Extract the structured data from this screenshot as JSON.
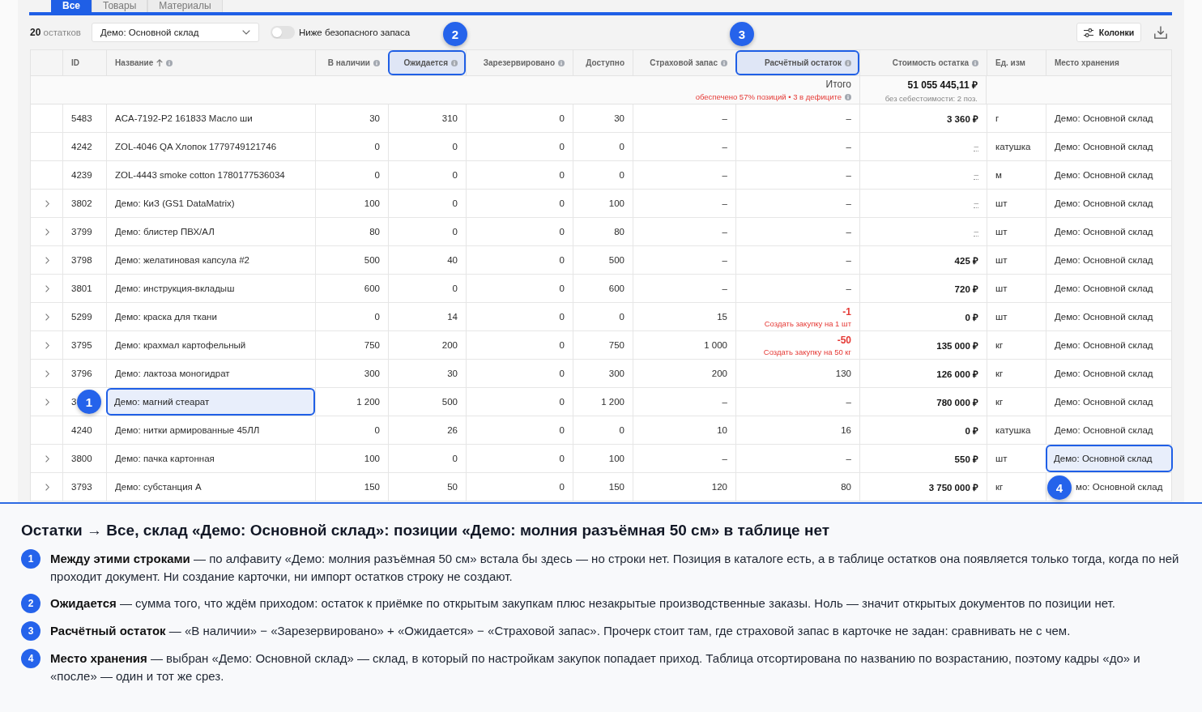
{
  "tabs": [
    {
      "label": "Все",
      "selected": true
    },
    {
      "label": "Товары",
      "selected": false
    },
    {
      "label": "Материалы",
      "selected": false
    }
  ],
  "toolbar": {
    "count_text": "**20** остатков",
    "warehouse_select": "Демо: Основной склад",
    "safety_filter": {
      "label": "Ниже безопасного запаса",
      "on": false
    },
    "columns_button": "Колонки"
  },
  "table": {
    "columns": [
      {
        "label": "ID",
        "sorted": false,
        "info": false,
        "highlighted": false
      },
      {
        "label": "Название",
        "sorted": true,
        "info": true,
        "highlighted": false
      },
      {
        "label": "В наличии",
        "sorted": false,
        "info": true,
        "highlighted": false
      },
      {
        "label": "Ожидается",
        "sorted": false,
        "info": true,
        "highlighted": true,
        "callout": "2"
      },
      {
        "label": "Зарезервировано",
        "sorted": false,
        "info": true,
        "highlighted": false
      },
      {
        "label": "Доступно",
        "sorted": false,
        "info": false,
        "highlighted": false
      },
      {
        "label": "Страховой запас",
        "sorted": false,
        "info": true,
        "highlighted": false
      },
      {
        "label": "Расчётный остаток",
        "sorted": false,
        "info": true,
        "highlighted": true,
        "callout": "3"
      },
      {
        "label": "Стоимость остатка",
        "sorted": false,
        "info": true,
        "highlighted": false
      },
      {
        "label": "Ед. изм",
        "sorted": false,
        "info": false,
        "highlighted": false
      },
      {
        "label": "Место хранения",
        "sorted": false,
        "info": false,
        "highlighted": false
      }
    ],
    "totals": {
      "label": "Итого",
      "coverage": "обеспечено 57% позиций • 3 в дефиците",
      "value": "51 055 445,11 ₽",
      "value_note": "без себестоимости: 2 поз."
    },
    "rows": [
      {
        "expandable": false,
        "id": "5483",
        "name": "ACA-7192-P2 161833 Масло ши",
        "in_stock": "30",
        "expected": "310",
        "reserved": "0",
        "available": "30",
        "safety_stock": "–",
        "projected": "–",
        "projected_deficit": false,
        "value": "3 360 ₽",
        "cost_known": true,
        "unit": "г",
        "location": "Демо: Основной склад",
        "name_highlighted": false,
        "location_highlighted": false
      },
      {
        "expandable": false,
        "id": "4242",
        "name": "ZOL-4046 QA Хлопок 1779749121746",
        "in_stock": "0",
        "expected": "0",
        "reserved": "0",
        "available": "0",
        "safety_stock": "–",
        "projected": "–",
        "projected_deficit": false,
        "value": "–",
        "cost_known": false,
        "unit": "катушка",
        "location": "Демо: Основной склад",
        "name_highlighted": false,
        "location_highlighted": false
      },
      {
        "expandable": false,
        "id": "4239",
        "name": "ZOL-4443 smoke cotton 1780177536034",
        "in_stock": "0",
        "expected": "0",
        "reserved": "0",
        "available": "0",
        "safety_stock": "–",
        "projected": "–",
        "projected_deficit": false,
        "value": "–",
        "cost_known": false,
        "unit": "м",
        "location": "Демо: Основной склад",
        "name_highlighted": false,
        "location_highlighted": false
      },
      {
        "expandable": true,
        "id": "3802",
        "name": "Демо: КиЗ (GS1 DataMatrix)",
        "in_stock": "100",
        "expected": "0",
        "reserved": "0",
        "available": "100",
        "safety_stock": "–",
        "projected": "–",
        "projected_deficit": false,
        "value": "–",
        "cost_known": false,
        "unit": "шт",
        "location": "Демо: Основной склад",
        "name_highlighted": false,
        "location_highlighted": false
      },
      {
        "expandable": true,
        "id": "3799",
        "name": "Демо: блистер ПВХ/АЛ",
        "in_stock": "80",
        "expected": "0",
        "reserved": "0",
        "available": "80",
        "safety_stock": "–",
        "projected": "–",
        "projected_deficit": false,
        "value": "–",
        "cost_known": false,
        "unit": "шт",
        "location": "Демо: Основной склад",
        "name_highlighted": false,
        "location_highlighted": false
      },
      {
        "expandable": true,
        "id": "3798",
        "name": "Демо: желатиновая капсула #2",
        "in_stock": "500",
        "expected": "40",
        "reserved": "0",
        "available": "500",
        "safety_stock": "–",
        "projected": "–",
        "projected_deficit": false,
        "value": "425 ₽",
        "cost_known": true,
        "unit": "шт",
        "location": "Демо: Основной склад",
        "name_highlighted": false,
        "location_highlighted": false
      },
      {
        "expandable": true,
        "id": "3801",
        "name": "Демо: инструкция-вкладыш",
        "in_stock": "600",
        "expected": "0",
        "reserved": "0",
        "available": "600",
        "safety_stock": "–",
        "projected": "–",
        "projected_deficit": false,
        "value": "720 ₽",
        "cost_known": true,
        "unit": "шт",
        "location": "Демо: Основной склад",
        "name_highlighted": false,
        "location_highlighted": false
      },
      {
        "expandable": true,
        "id": "5299",
        "name": "Демо: краска для ткани",
        "in_stock": "0",
        "expected": "14",
        "reserved": "0",
        "available": "0",
        "safety_stock": "15",
        "projected": "-1",
        "projected_deficit": true,
        "purchase_link": "Создать закупку на 1 шт",
        "value": "0 ₽",
        "cost_known": true,
        "unit": "шт",
        "location": "Демо: Основной склад",
        "name_highlighted": false,
        "location_highlighted": false
      },
      {
        "expandable": true,
        "id": "3795",
        "name": "Демо: крахмал картофельный",
        "in_stock": "750",
        "expected": "200",
        "reserved": "0",
        "available": "750",
        "safety_stock": "1 000",
        "projected": "-50",
        "projected_deficit": true,
        "purchase_link": "Создать закупку на 50 кг",
        "value": "135 000 ₽",
        "cost_known": true,
        "unit": "кг",
        "location": "Демо: Основной склад",
        "name_highlighted": false,
        "location_highlighted": false
      },
      {
        "expandable": true,
        "id": "3796",
        "name": "Демо: лактоза моногидрат",
        "in_stock": "300",
        "expected": "30",
        "reserved": "0",
        "available": "300",
        "safety_stock": "200",
        "projected": "130",
        "projected_deficit": false,
        "value": "126 000 ₽",
        "cost_known": true,
        "unit": "кг",
        "location": "Демо: Основной склад",
        "name_highlighted": false,
        "location_highlighted": false
      },
      {
        "expandable": true,
        "id": "3",
        "id_callout": "1",
        "name": "Демо: магний стеарат",
        "in_stock": "1 200",
        "expected": "500",
        "reserved": "0",
        "available": "1 200",
        "safety_stock": "–",
        "projected": "–",
        "projected_deficit": false,
        "value": "780 000 ₽",
        "cost_known": true,
        "unit": "кг",
        "location": "Демо: Основной склад",
        "name_highlighted": true,
        "location_highlighted": false
      },
      {
        "expandable": false,
        "id": "4240",
        "name": "Демо: нитки армированные 45ЛЛ",
        "in_stock": "0",
        "expected": "26",
        "reserved": "0",
        "available": "0",
        "safety_stock": "10",
        "projected": "16",
        "projected_deficit": false,
        "value": "0 ₽",
        "cost_known": true,
        "unit": "катушка",
        "location": "Демо: Основной склад",
        "name_highlighted": false,
        "location_highlighted": false
      },
      {
        "expandable": true,
        "id": "3800",
        "name": "Демо: пачка картонная",
        "in_stock": "100",
        "expected": "0",
        "reserved": "0",
        "available": "100",
        "safety_stock": "–",
        "projected": "–",
        "projected_deficit": false,
        "value": "550 ₽",
        "cost_known": true,
        "unit": "шт",
        "location": "Демо: Основной склад",
        "name_highlighted": false,
        "location_highlighted": true
      },
      {
        "expandable": true,
        "id": "3793",
        "name": "Демо: субстанция А",
        "in_stock": "150",
        "expected": "50",
        "reserved": "0",
        "available": "150",
        "safety_stock": "120",
        "projected": "80",
        "projected_deficit": false,
        "value": "3 750 000 ₽",
        "cost_known": true,
        "unit": "кг",
        "location": "мо: Основной склад",
        "location_callout": "4",
        "name_highlighted": false,
        "location_highlighted": false
      }
    ]
  },
  "notes": {
    "title": "Остатки → Все, склад «Демо: Основной склад»: позиции «Демо: молния разъёмная 50 см» в таблице нет",
    "items": [
      {
        "number": "1",
        "text": "**Между этими строками** — по алфавиту «Демо: молния разъёмная 50 см» встала бы здесь — но строки нет. Позиция в каталоге есть, а в таблице остатков она появляется только тогда, когда по ней проходит документ. Ни создание карточки, ни импорт остатков строку не создают."
      },
      {
        "number": "2",
        "text": "**Ожидается** — сумма того, что ждём приходом: остаток к приёмке по открытым закупкам плюс незакрытые производственные заказы. Ноль — значит открытых документов по позиции нет."
      },
      {
        "number": "3",
        "text": "**Расчётный остаток** — «В наличии» − «Зарезервировано» + «Ожидается» − «Страховой запас». Прочерк стоит там, где страховой запас в карточке не задан: сравнивать не с чем."
      },
      {
        "number": "4",
        "text": "**Место хранения** — выбран «Демо: Основной склад» — склад, в который по настройкам закупок попадает приход. Таблица отсортирована по названию по возрастанию, поэтому кадры «до» и «после» — один и тот же срез."
      }
    ]
  }
}
